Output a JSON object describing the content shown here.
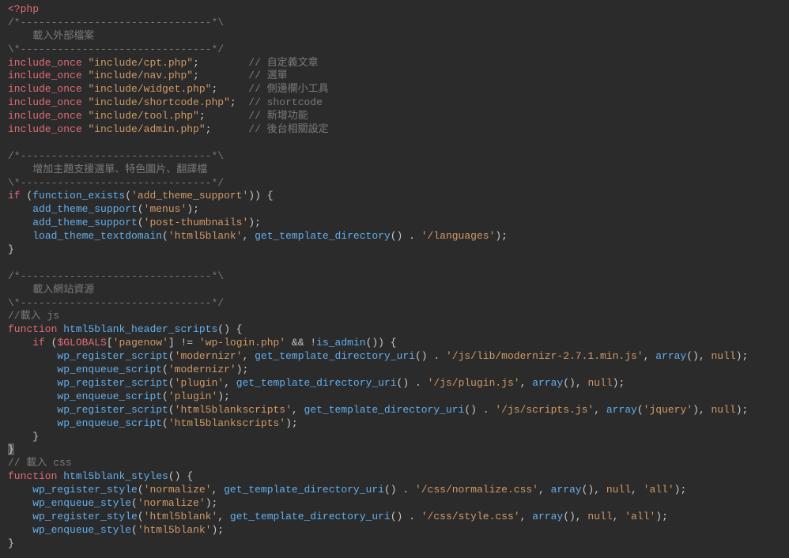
{
  "code_lines": [
    {
      "segments": [
        {
          "cls": "tag",
          "t": "<?php"
        }
      ]
    },
    {
      "segments": [
        {
          "cls": "comment",
          "t": "/*-------------------------------*\\"
        }
      ]
    },
    {
      "segments": [
        {
          "cls": "comment",
          "t": "    載入外部檔案"
        }
      ]
    },
    {
      "segments": [
        {
          "cls": "comment",
          "t": "\\*-------------------------------*/"
        }
      ]
    },
    {
      "segments": [
        {
          "cls": "key",
          "t": "include_once"
        },
        {
          "cls": "punct",
          "t": " "
        },
        {
          "cls": "string",
          "t": "\"include/cpt.php\""
        },
        {
          "cls": "punct",
          "t": ";        "
        },
        {
          "cls": "comment",
          "t": "// 自定義文章"
        }
      ]
    },
    {
      "segments": [
        {
          "cls": "key",
          "t": "include_once"
        },
        {
          "cls": "punct",
          "t": " "
        },
        {
          "cls": "string",
          "t": "\"include/nav.php\""
        },
        {
          "cls": "punct",
          "t": ";        "
        },
        {
          "cls": "comment",
          "t": "// 選單"
        }
      ]
    },
    {
      "segments": [
        {
          "cls": "key",
          "t": "include_once"
        },
        {
          "cls": "punct",
          "t": " "
        },
        {
          "cls": "string",
          "t": "\"include/widget.php\""
        },
        {
          "cls": "punct",
          "t": ";     "
        },
        {
          "cls": "comment",
          "t": "// 側邊欄小工具"
        }
      ]
    },
    {
      "segments": [
        {
          "cls": "key",
          "t": "include_once"
        },
        {
          "cls": "punct",
          "t": " "
        },
        {
          "cls": "string",
          "t": "\"include/shortcode.php\""
        },
        {
          "cls": "punct",
          "t": ";  "
        },
        {
          "cls": "comment",
          "t": "// shortcode"
        }
      ]
    },
    {
      "segments": [
        {
          "cls": "key",
          "t": "include_once"
        },
        {
          "cls": "punct",
          "t": " "
        },
        {
          "cls": "string",
          "t": "\"include/tool.php\""
        },
        {
          "cls": "punct",
          "t": ";       "
        },
        {
          "cls": "comment",
          "t": "// 新增功能"
        }
      ]
    },
    {
      "segments": [
        {
          "cls": "key",
          "t": "include_once"
        },
        {
          "cls": "punct",
          "t": " "
        },
        {
          "cls": "string",
          "t": "\"include/admin.php\""
        },
        {
          "cls": "punct",
          "t": ";      "
        },
        {
          "cls": "comment",
          "t": "// 後台相關設定"
        }
      ]
    },
    {
      "segments": [
        {
          "cls": "",
          "t": ""
        }
      ]
    },
    {
      "segments": [
        {
          "cls": "comment",
          "t": "/*-------------------------------*\\"
        }
      ]
    },
    {
      "segments": [
        {
          "cls": "comment",
          "t": "    增加主題支援選單、特色圖片、翻譯檔"
        }
      ]
    },
    {
      "segments": [
        {
          "cls": "comment",
          "t": "\\*-------------------------------*/"
        }
      ]
    },
    {
      "segments": [
        {
          "cls": "key",
          "t": "if"
        },
        {
          "cls": "punct",
          "t": " ("
        },
        {
          "cls": "func",
          "t": "function_exists"
        },
        {
          "cls": "punct",
          "t": "("
        },
        {
          "cls": "string",
          "t": "'add_theme_support'"
        },
        {
          "cls": "punct",
          "t": ")) {"
        }
      ]
    },
    {
      "segments": [
        {
          "cls": "punct",
          "t": "    "
        },
        {
          "cls": "func",
          "t": "add_theme_support"
        },
        {
          "cls": "punct",
          "t": "("
        },
        {
          "cls": "string",
          "t": "'menus'"
        },
        {
          "cls": "punct",
          "t": ");"
        }
      ]
    },
    {
      "segments": [
        {
          "cls": "punct",
          "t": "    "
        },
        {
          "cls": "func",
          "t": "add_theme_support"
        },
        {
          "cls": "punct",
          "t": "("
        },
        {
          "cls": "string",
          "t": "'post-thumbnails'"
        },
        {
          "cls": "punct",
          "t": ");"
        }
      ]
    },
    {
      "segments": [
        {
          "cls": "punct",
          "t": "    "
        },
        {
          "cls": "func",
          "t": "load_theme_textdomain"
        },
        {
          "cls": "punct",
          "t": "("
        },
        {
          "cls": "string",
          "t": "'html5blank'"
        },
        {
          "cls": "punct",
          "t": ", "
        },
        {
          "cls": "func",
          "t": "get_template_directory"
        },
        {
          "cls": "punct",
          "t": "() . "
        },
        {
          "cls": "string",
          "t": "'/languages'"
        },
        {
          "cls": "punct",
          "t": ");"
        }
      ]
    },
    {
      "segments": [
        {
          "cls": "punct",
          "t": "}"
        }
      ]
    },
    {
      "segments": [
        {
          "cls": "",
          "t": ""
        }
      ]
    },
    {
      "segments": [
        {
          "cls": "comment",
          "t": "/*-------------------------------*\\"
        }
      ]
    },
    {
      "segments": [
        {
          "cls": "comment",
          "t": "    載入網站資源"
        }
      ]
    },
    {
      "segments": [
        {
          "cls": "comment",
          "t": "\\*-------------------------------*/"
        }
      ]
    },
    {
      "segments": [
        {
          "cls": "comment",
          "t": "//載入 js"
        }
      ]
    },
    {
      "segments": [
        {
          "cls": "key",
          "t": "function"
        },
        {
          "cls": "punct",
          "t": " "
        },
        {
          "cls": "func",
          "t": "html5blank_header_scripts"
        },
        {
          "cls": "punct",
          "t": "() {"
        }
      ]
    },
    {
      "segments": [
        {
          "cls": "punct",
          "t": "    "
        },
        {
          "cls": "key",
          "t": "if"
        },
        {
          "cls": "punct",
          "t": " ("
        },
        {
          "cls": "var",
          "t": "$GLOBALS"
        },
        {
          "cls": "punct",
          "t": "["
        },
        {
          "cls": "string",
          "t": "'pagenow'"
        },
        {
          "cls": "punct",
          "t": "] != "
        },
        {
          "cls": "string",
          "t": "'wp-login.php'"
        },
        {
          "cls": "punct",
          "t": " && !"
        },
        {
          "cls": "func",
          "t": "is_admin"
        },
        {
          "cls": "punct",
          "t": "()) {"
        }
      ]
    },
    {
      "segments": [
        {
          "cls": "punct",
          "t": "        "
        },
        {
          "cls": "func",
          "t": "wp_register_script"
        },
        {
          "cls": "punct",
          "t": "("
        },
        {
          "cls": "string",
          "t": "'modernizr'"
        },
        {
          "cls": "punct",
          "t": ", "
        },
        {
          "cls": "func",
          "t": "get_template_directory_uri"
        },
        {
          "cls": "punct",
          "t": "() . "
        },
        {
          "cls": "string",
          "t": "'/js/lib/modernizr-2.7.1.min.js'"
        },
        {
          "cls": "punct",
          "t": ", "
        },
        {
          "cls": "func",
          "t": "array"
        },
        {
          "cls": "punct",
          "t": "(), "
        },
        {
          "cls": "const",
          "t": "null"
        },
        {
          "cls": "punct",
          "t": ");"
        }
      ]
    },
    {
      "segments": [
        {
          "cls": "punct",
          "t": "        "
        },
        {
          "cls": "func",
          "t": "wp_enqueue_script"
        },
        {
          "cls": "punct",
          "t": "("
        },
        {
          "cls": "string",
          "t": "'modernizr'"
        },
        {
          "cls": "punct",
          "t": ");"
        }
      ]
    },
    {
      "segments": [
        {
          "cls": "punct",
          "t": "        "
        },
        {
          "cls": "func",
          "t": "wp_register_script"
        },
        {
          "cls": "punct",
          "t": "("
        },
        {
          "cls": "string",
          "t": "'plugin'"
        },
        {
          "cls": "punct",
          "t": ", "
        },
        {
          "cls": "func",
          "t": "get_template_directory_uri"
        },
        {
          "cls": "punct",
          "t": "() . "
        },
        {
          "cls": "string",
          "t": "'/js/plugin.js'"
        },
        {
          "cls": "punct",
          "t": ", "
        },
        {
          "cls": "func",
          "t": "array"
        },
        {
          "cls": "punct",
          "t": "(), "
        },
        {
          "cls": "const",
          "t": "null"
        },
        {
          "cls": "punct",
          "t": ");"
        }
      ]
    },
    {
      "segments": [
        {
          "cls": "punct",
          "t": "        "
        },
        {
          "cls": "func",
          "t": "wp_enqueue_script"
        },
        {
          "cls": "punct",
          "t": "("
        },
        {
          "cls": "string",
          "t": "'plugin'"
        },
        {
          "cls": "punct",
          "t": ");"
        }
      ]
    },
    {
      "segments": [
        {
          "cls": "punct",
          "t": "        "
        },
        {
          "cls": "func",
          "t": "wp_register_script"
        },
        {
          "cls": "punct",
          "t": "("
        },
        {
          "cls": "string",
          "t": "'html5blankscripts'"
        },
        {
          "cls": "punct",
          "t": ", "
        },
        {
          "cls": "func",
          "t": "get_template_directory_uri"
        },
        {
          "cls": "punct",
          "t": "() . "
        },
        {
          "cls": "string",
          "t": "'/js/scripts.js'"
        },
        {
          "cls": "punct",
          "t": ", "
        },
        {
          "cls": "func",
          "t": "array"
        },
        {
          "cls": "punct",
          "t": "("
        },
        {
          "cls": "string",
          "t": "'jquery'"
        },
        {
          "cls": "punct",
          "t": "), "
        },
        {
          "cls": "const",
          "t": "null"
        },
        {
          "cls": "punct",
          "t": ");"
        }
      ]
    },
    {
      "segments": [
        {
          "cls": "punct",
          "t": "        "
        },
        {
          "cls": "func",
          "t": "wp_enqueue_script"
        },
        {
          "cls": "punct",
          "t": "("
        },
        {
          "cls": "string",
          "t": "'html5blankscripts'"
        },
        {
          "cls": "punct",
          "t": ");"
        }
      ]
    },
    {
      "segments": [
        {
          "cls": "punct",
          "t": "    }"
        }
      ]
    },
    {
      "segments": [
        {
          "cls": "cursor",
          "t": "}"
        }
      ]
    },
    {
      "segments": [
        {
          "cls": "comment",
          "t": "// 載入 css"
        }
      ]
    },
    {
      "segments": [
        {
          "cls": "key",
          "t": "function"
        },
        {
          "cls": "punct",
          "t": " "
        },
        {
          "cls": "func",
          "t": "html5blank_styles"
        },
        {
          "cls": "punct",
          "t": "() {"
        }
      ]
    },
    {
      "segments": [
        {
          "cls": "punct",
          "t": "    "
        },
        {
          "cls": "func",
          "t": "wp_register_style"
        },
        {
          "cls": "punct",
          "t": "("
        },
        {
          "cls": "string",
          "t": "'normalize'"
        },
        {
          "cls": "punct",
          "t": ", "
        },
        {
          "cls": "func",
          "t": "get_template_directory_uri"
        },
        {
          "cls": "punct",
          "t": "() . "
        },
        {
          "cls": "string",
          "t": "'/css/normalize.css'"
        },
        {
          "cls": "punct",
          "t": ", "
        },
        {
          "cls": "func",
          "t": "array"
        },
        {
          "cls": "punct",
          "t": "(), "
        },
        {
          "cls": "const",
          "t": "null"
        },
        {
          "cls": "punct",
          "t": ", "
        },
        {
          "cls": "string",
          "t": "'all'"
        },
        {
          "cls": "punct",
          "t": ");"
        }
      ]
    },
    {
      "segments": [
        {
          "cls": "punct",
          "t": "    "
        },
        {
          "cls": "func",
          "t": "wp_enqueue_style"
        },
        {
          "cls": "punct",
          "t": "("
        },
        {
          "cls": "string",
          "t": "'normalize'"
        },
        {
          "cls": "punct",
          "t": ");"
        }
      ]
    },
    {
      "segments": [
        {
          "cls": "punct",
          "t": "    "
        },
        {
          "cls": "func",
          "t": "wp_register_style"
        },
        {
          "cls": "punct",
          "t": "("
        },
        {
          "cls": "string",
          "t": "'html5blank'"
        },
        {
          "cls": "punct",
          "t": ", "
        },
        {
          "cls": "func",
          "t": "get_template_directory_uri"
        },
        {
          "cls": "punct",
          "t": "() . "
        },
        {
          "cls": "string",
          "t": "'/css/style.css'"
        },
        {
          "cls": "punct",
          "t": ", "
        },
        {
          "cls": "func",
          "t": "array"
        },
        {
          "cls": "punct",
          "t": "(), "
        },
        {
          "cls": "const",
          "t": "null"
        },
        {
          "cls": "punct",
          "t": ", "
        },
        {
          "cls": "string",
          "t": "'all'"
        },
        {
          "cls": "punct",
          "t": ");"
        }
      ]
    },
    {
      "segments": [
        {
          "cls": "punct",
          "t": "    "
        },
        {
          "cls": "func",
          "t": "wp_enqueue_style"
        },
        {
          "cls": "punct",
          "t": "("
        },
        {
          "cls": "string",
          "t": "'html5blank'"
        },
        {
          "cls": "punct",
          "t": ");"
        }
      ]
    },
    {
      "segments": [
        {
          "cls": "punct",
          "t": "}"
        }
      ]
    }
  ]
}
